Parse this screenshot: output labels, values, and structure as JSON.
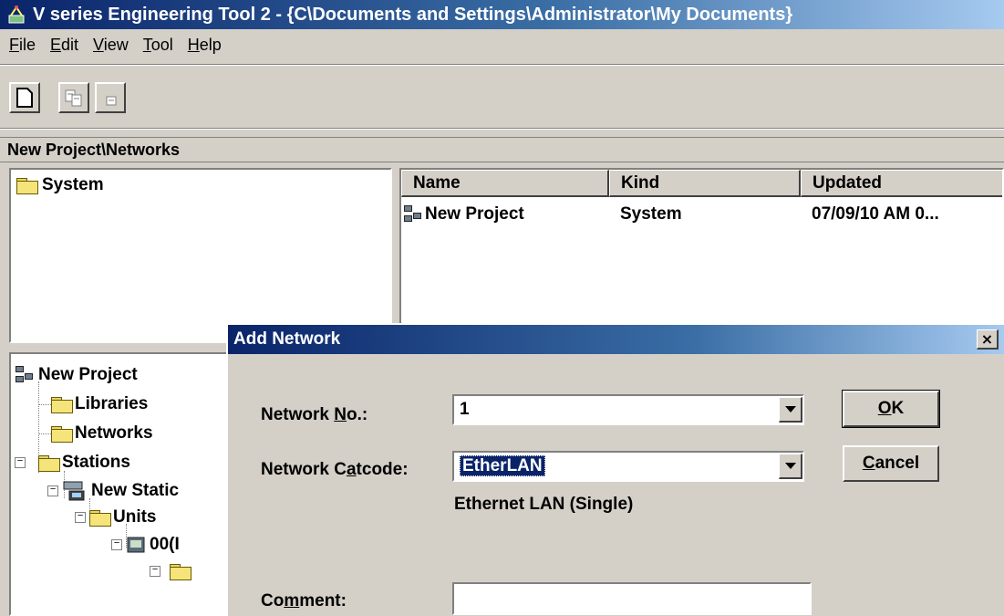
{
  "window": {
    "title": "V series Engineering Tool 2 - {C\\Documents and Settings\\Administrator\\My Documents}"
  },
  "menu": [
    {
      "label": "File",
      "key": "F",
      "rest": "ile"
    },
    {
      "label": "Edit",
      "key": "E",
      "rest": "dit"
    },
    {
      "label": "View",
      "key": "V",
      "rest": "iew"
    },
    {
      "label": "Tool",
      "key": "T",
      "rest": "ool"
    },
    {
      "label": "Help",
      "key": "H",
      "rest": "elp"
    }
  ],
  "toolbar": {
    "buttons": [
      "new-document-icon",
      "copy-icon",
      "paste-icon"
    ]
  },
  "path": "New Project\\Networks",
  "system_pane": {
    "item": "System"
  },
  "list": {
    "headers": [
      "Name",
      "Kind",
      "Updated"
    ],
    "rows": [
      {
        "name": "New Project",
        "kind": "System",
        "updated": "07/09/10 AM 0..."
      }
    ]
  },
  "tree": {
    "root": "New Project",
    "libraries": "Libraries",
    "networks": "Networks",
    "stations": "Stations",
    "station": "New Static",
    "units": "Units",
    "unit": "00(I"
  },
  "dialog": {
    "title": "Add Network",
    "close": "×",
    "network_no_label_pre": "Network ",
    "network_no_label_key": "N",
    "network_no_label_post": "o.:",
    "network_no_value": "1",
    "catcode_label_pre": "Network C",
    "catcode_label_key": "a",
    "catcode_label_post": "tcode:",
    "catcode_value": "EtherLAN",
    "catcode_desc": "Ethernet LAN (Single)",
    "comment_label_pre": "Co",
    "comment_label_key": "m",
    "comment_label_post": "ment:",
    "comment_value": "",
    "ok_key": "O",
    "ok_rest": "K",
    "cancel_key": "C",
    "cancel_rest": "ancel"
  }
}
